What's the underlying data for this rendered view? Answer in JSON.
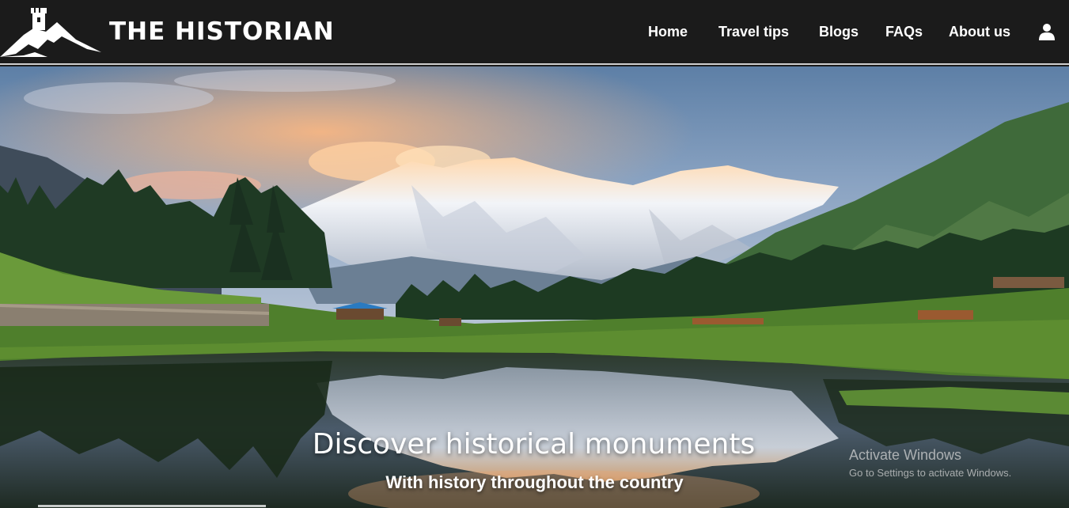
{
  "brand": {
    "name": "THE HISTORIAN",
    "logo_icon": "mountain-castle-logo"
  },
  "nav": {
    "items": [
      {
        "label": "Home"
      },
      {
        "label": "Travel tips"
      },
      {
        "label": "Blogs"
      },
      {
        "label": "FAQs"
      },
      {
        "label": "About us"
      }
    ],
    "account_icon": "user-icon"
  },
  "hero": {
    "title": "Discover historical monuments",
    "subtitle": "With history throughout the country"
  },
  "watermark": {
    "title": "Activate Windows",
    "subtitle": "Go to Settings to activate Windows."
  },
  "colors": {
    "navbar": "#1b1b1b",
    "text": "#ffffff",
    "navbar_border": "#cfcfcf"
  }
}
